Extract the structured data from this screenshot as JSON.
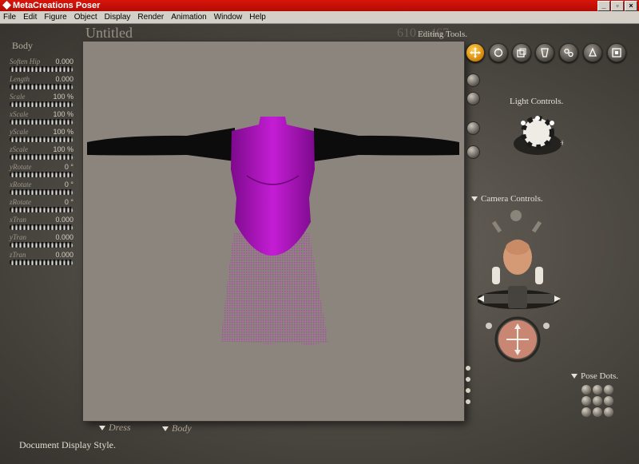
{
  "window": {
    "title": "MetaCreations Poser"
  },
  "menu": [
    "File",
    "Edit",
    "Figure",
    "Object",
    "Display",
    "Render",
    "Animation",
    "Window",
    "Help"
  ],
  "document": {
    "title": "Untitled",
    "size": "610 × 467"
  },
  "body_panel": {
    "title": "Body",
    "dials": [
      {
        "label": "Soften Hip",
        "value": "0.000"
      },
      {
        "label": "Length",
        "value": "0.000"
      },
      {
        "label": "Scale",
        "value": "100 %"
      },
      {
        "label": "xScale",
        "value": "100 %"
      },
      {
        "label": "yScale",
        "value": "100 %"
      },
      {
        "label": "zScale",
        "value": "100 %"
      },
      {
        "label": "yRotate",
        "value": "0 °"
      },
      {
        "label": "xRotate",
        "value": "0 °"
      },
      {
        "label": "zRotate",
        "value": "0 °"
      },
      {
        "label": "xTran",
        "value": "0.000"
      },
      {
        "label": "yTran",
        "value": "0.000"
      },
      {
        "label": "zTran",
        "value": "0.000"
      }
    ]
  },
  "editing_tools": {
    "label": "Editing Tools.",
    "tools": [
      "translate-icon",
      "rotate-icon",
      "scale-icon",
      "taper-icon",
      "chain-icon",
      "color-icon",
      "view-magnifier-icon"
    ]
  },
  "light_controls": {
    "label": "Light Controls."
  },
  "camera_controls": {
    "label": "Camera Controls."
  },
  "pose_dots": {
    "label": "Pose Dots."
  },
  "figure_menu": {
    "label": "Dress"
  },
  "body_menu": {
    "label": "Body"
  },
  "status": {
    "label": "Document Display Style."
  },
  "colors": {
    "titlebar": "#c4100a",
    "dress_top": "#b015c0",
    "sleeves": "#111111",
    "viewport": "#8b857e",
    "accent": "#e09a0a"
  }
}
